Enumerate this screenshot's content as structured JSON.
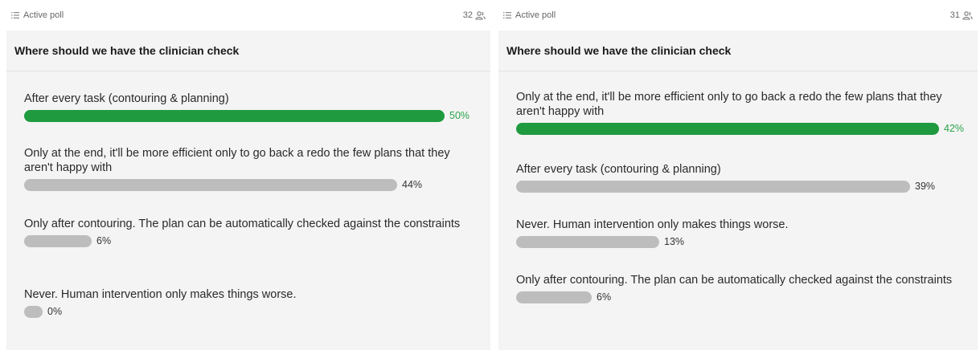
{
  "panels": [
    {
      "header": {
        "label": "Active poll",
        "count": "32"
      },
      "question": "Where should we have the clinician check",
      "options": [
        {
          "text": "After every task (contouring & planning)",
          "percent_label": "50%",
          "percent": 50,
          "winner": true
        },
        {
          "text": "Only at the end, it'll be more efficient only to go back a redo the few plans that they aren't happy with",
          "percent_label": "44%",
          "percent": 44,
          "winner": false
        },
        {
          "text": "Only after contouring. The plan can be automatically checked against the constraints",
          "percent_label": "6%",
          "percent": 6,
          "winner": false
        },
        {
          "text": "Never. Human intervention only makes things worse.",
          "percent_label": "0%",
          "percent": 0,
          "winner": false
        }
      ]
    },
    {
      "header": {
        "label": "Active poll",
        "count": "31"
      },
      "question": "Where should we have the clinician check",
      "options": [
        {
          "text": "Only at the end, it'll be more efficient only to go back a redo the few plans that they aren't happy with",
          "percent_label": "42%",
          "percent": 42,
          "winner": true
        },
        {
          "text": "After every task (contouring & planning)",
          "percent_label": "39%",
          "percent": 39,
          "winner": false
        },
        {
          "text": "Never. Human intervention only makes things worse.",
          "percent_label": "13%",
          "percent": 13,
          "winner": false
        },
        {
          "text": "Only after contouring. The plan can be automatically checked against the constraints",
          "percent_label": "6%",
          "percent": 6,
          "winner": false
        }
      ]
    }
  ],
  "colors": {
    "winner_bar": "#1f9a3f",
    "other_bar": "#bdbdbd",
    "card_bg": "#f4f4f4"
  },
  "icons": {
    "header": "list-icon",
    "count": "people-icon"
  }
}
